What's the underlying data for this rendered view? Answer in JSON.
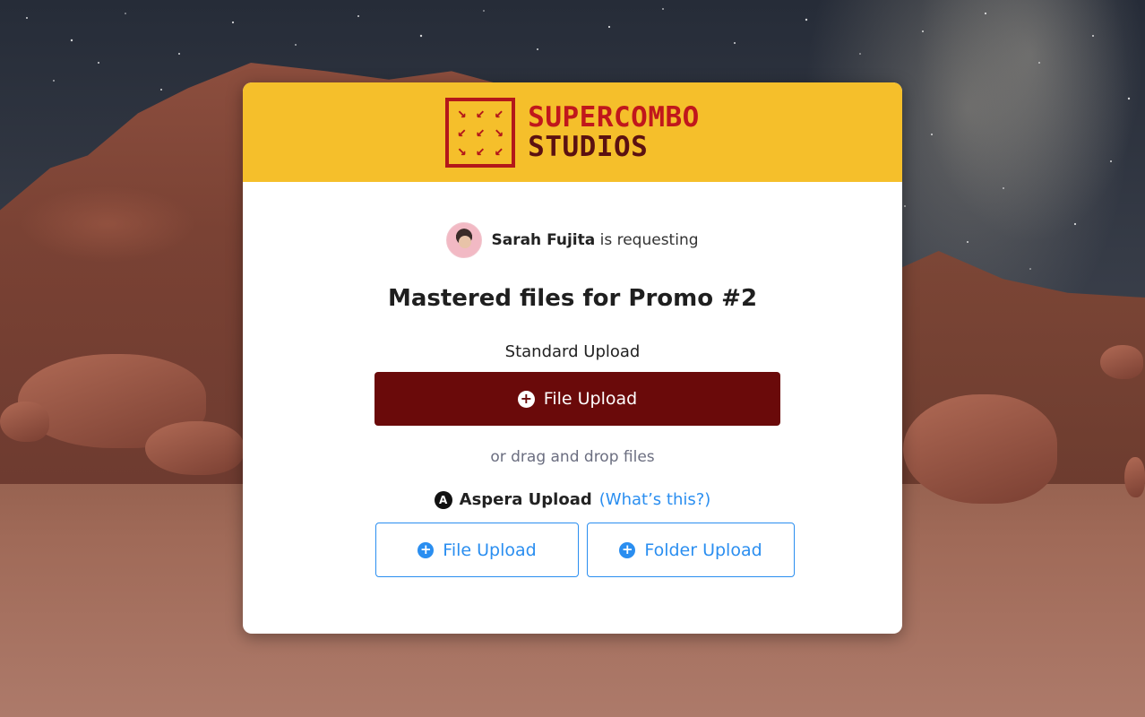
{
  "brand": {
    "line1": "SUPERCOMBO",
    "line2": "STUDIOS",
    "logo_glyphs": [
      "↘",
      "↙",
      "↙",
      "↙",
      "↙",
      "↘",
      "↘",
      "↙",
      "↙"
    ],
    "header_color": "#f5bf2b",
    "accent_color": "#b3171a"
  },
  "request": {
    "requester_name": "Sarah Fujita",
    "requester_suffix": "is requesting",
    "title": "Mastered files for Promo #2"
  },
  "standard_upload": {
    "label": "Standard Upload",
    "button_label": "File Upload",
    "button_icon": "plus-circle-icon",
    "drag_text": "or drag and drop files"
  },
  "aspera_upload": {
    "label": "Aspera Upload",
    "help_link": "(What’s this?)",
    "icon": "aspera-icon",
    "file_button_label": "File Upload",
    "folder_button_label": "Folder Upload",
    "link_color": "#2a8ef0"
  },
  "colors": {
    "primary_button": "#6a0a0a"
  }
}
